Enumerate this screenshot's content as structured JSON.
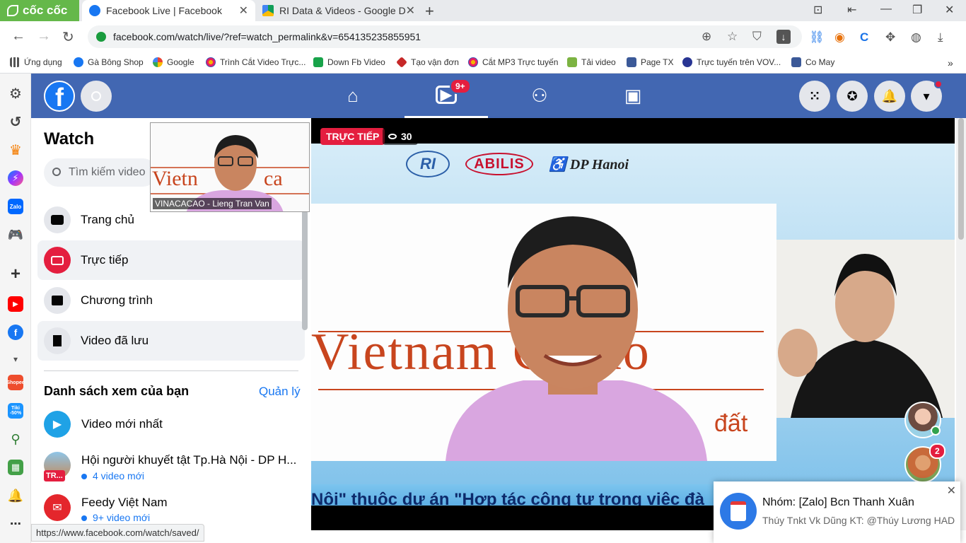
{
  "browser": {
    "brand": "cốc cốc",
    "tabs": [
      {
        "title": "Facebook Live | Facebook",
        "active": true
      },
      {
        "title": "RI Data & Videos - Google D",
        "active": false
      }
    ],
    "url": "facebook.com/watch/live/?ref=watch_permalink&v=654135235855951",
    "bookmarks": [
      "Ứng dụng",
      "Gà Bông Shop",
      "Google",
      "Trình Cắt Video Trực...",
      "Down Fb Video",
      "Tạo vận đơn",
      "Cắt MP3 Trực tuyến",
      "Tải video",
      "Page TX",
      "Trực tuyến trên VOV...",
      "Co May"
    ],
    "status_url": "https://www.facebook.com/watch/saved/"
  },
  "rail": {
    "tiki_label": "Tiki -50%",
    "shopee_label": "Shopee"
  },
  "header": {
    "video_badge": "9+"
  },
  "sidebar": {
    "title": "Watch",
    "search_placeholder": "Tìm kiếm video",
    "items": [
      {
        "label": "Trang chủ"
      },
      {
        "label": "Trực tiếp"
      },
      {
        "label": "Chương trình"
      },
      {
        "label": "Video đã lưu"
      }
    ],
    "watchlist_title": "Danh sách xem của bạn",
    "manage_label": "Quản lý",
    "watchlist": [
      {
        "title": "Video mới nhất",
        "sub": ""
      },
      {
        "title": "Hội người khuyết tật Tp.Hà Nội - DP H...",
        "sub": "4 video mới",
        "tag": "TR..."
      },
      {
        "title": "Feedy Việt Nam",
        "sub": "9+ video mới"
      }
    ]
  },
  "video": {
    "live_label": "TRỰC TIẾP",
    "viewer_count": "30",
    "logos": {
      "ri": "RI",
      "abilis": "ABILIS",
      "dp": "DP Hanoi"
    },
    "banner_text": "Vietnam Cacao",
    "banner_sub": "đất",
    "ticker": "Nội\" thuộc dự án \"Hợp tác công tư trong việc đà",
    "pip_name": "VINACACAO - Lieng Tran Van"
  },
  "chat": {
    "unread_badge": "2"
  },
  "toast": {
    "title": "Nhóm: [Zalo] Bcn Thanh Xuân",
    "message": "Thúy Tnkt Vk Dũng KT: @Thúy Lương HAD..."
  },
  "colors": {
    "facebook_header": "#4267b2",
    "live_red": "#e41e3f",
    "link_blue": "#1877f2",
    "coccoc_green": "#65b84a"
  }
}
